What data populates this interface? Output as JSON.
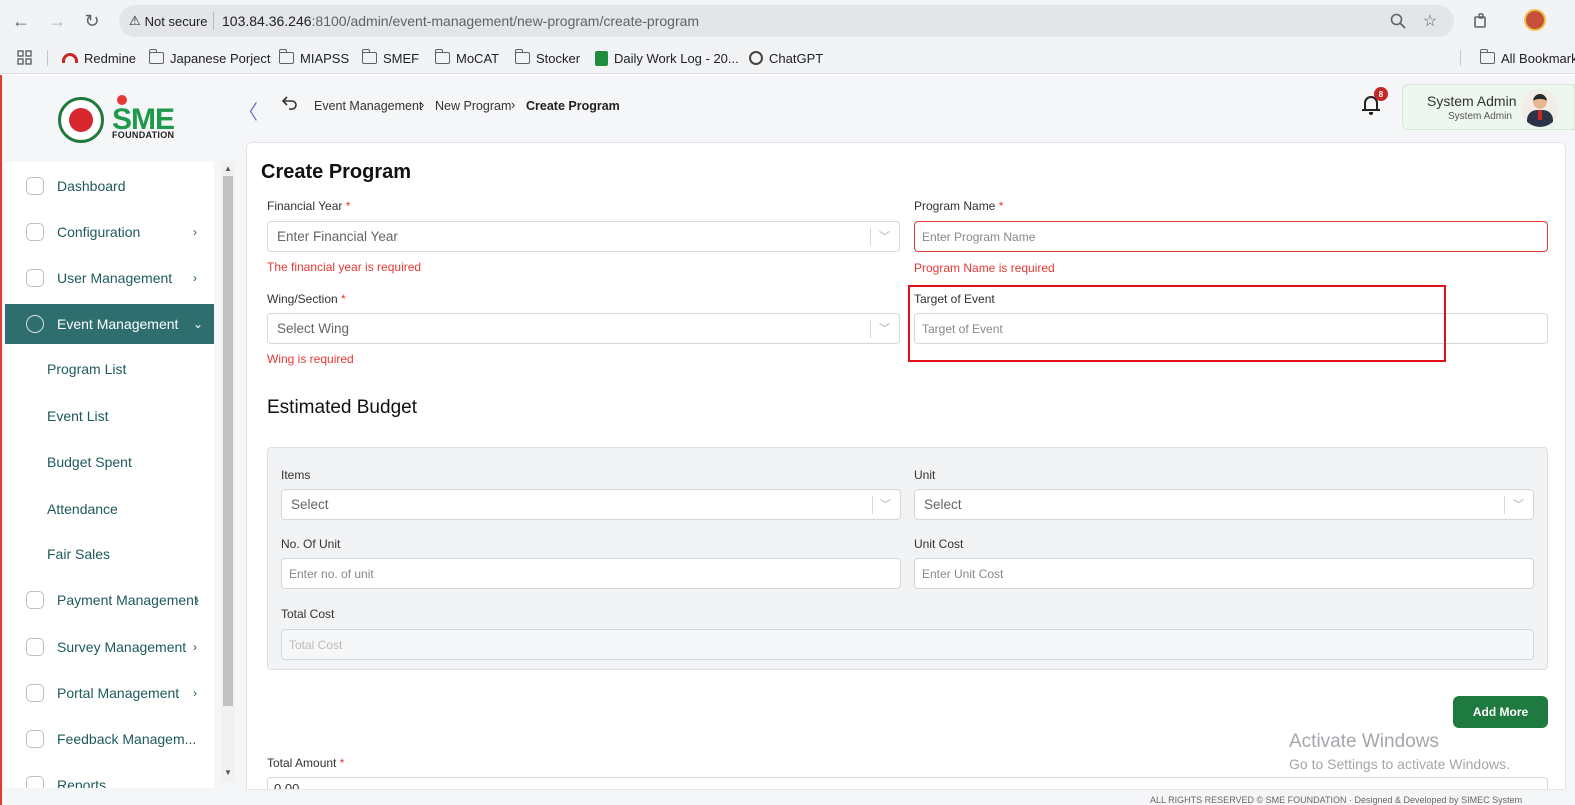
{
  "browser": {
    "security_label": "Not secure",
    "url_host": "103.84.36.246",
    "url_path": ":8100/admin/event-management/new-program/create-program",
    "bookmarks": [
      "Redmine",
      "Japanese Porject",
      "MIAPSS",
      "SMEF",
      "MoCAT",
      "Stocker",
      "Daily Work Log - 20...",
      "ChatGPT"
    ],
    "all_bookmarks": "All Bookmarks"
  },
  "logo": {
    "text": "SME",
    "subtitle": "FOUNDATION"
  },
  "sidebar": {
    "items": [
      {
        "label": "Dashboard",
        "icon": "dashboard-icon"
      },
      {
        "label": "Configuration",
        "icon": "configuration-icon",
        "chevron": "›"
      },
      {
        "label": "User Management",
        "icon": "user-management-icon",
        "chevron": "›"
      },
      {
        "label": "Event Management",
        "icon": "event-management-icon",
        "chevron": "⌄",
        "active": true
      },
      {
        "label": "Payment Management",
        "icon": "payment-icon",
        "chevron": "›"
      },
      {
        "label": "Survey Management",
        "icon": "survey-icon",
        "chevron": "›"
      },
      {
        "label": "Portal Management",
        "icon": "portal-icon",
        "chevron": "›"
      },
      {
        "label": "Feedback Managem...",
        "icon": "feedback-icon"
      },
      {
        "label": "Reports",
        "icon": "reports-icon"
      }
    ],
    "sub_items": [
      "Program List",
      "Event List",
      "Budget Spent",
      "Attendance",
      "Fair Sales"
    ]
  },
  "header": {
    "breadcrumb": [
      "Event Management",
      "New Program",
      "Create Program"
    ],
    "notification_count": "8",
    "user_name": "System Admin",
    "user_role": "System Admin"
  },
  "form": {
    "title": "Create Program",
    "financial_year": {
      "label": "Financial Year",
      "placeholder": "Enter Financial Year",
      "error": "The financial year is required"
    },
    "program_name": {
      "label": "Program Name",
      "placeholder": "Enter Program Name",
      "error": "Program Name is required"
    },
    "wing": {
      "label": "Wing/Section",
      "placeholder": "Select Wing",
      "error": "Wing is required"
    },
    "target_of_event": {
      "label": "Target of Event",
      "placeholder": "Target of Event"
    },
    "required_mark": "*"
  },
  "budget": {
    "title": "Estimated Budget",
    "items": {
      "label": "Items",
      "placeholder": "Select"
    },
    "unit": {
      "label": "Unit",
      "placeholder": "Select"
    },
    "no_of_unit": {
      "label": "No. Of Unit",
      "placeholder": "Enter no. of unit"
    },
    "unit_cost": {
      "label": "Unit Cost",
      "placeholder": "Enter Unit Cost"
    },
    "total_cost": {
      "label": "Total Cost",
      "placeholder": "Total Cost"
    },
    "add_more": "Add More"
  },
  "total_amount": {
    "label": "Total Amount",
    "value": "0.00"
  },
  "watermark": {
    "title": "Activate Windows",
    "subtitle": "Go to Settings to activate Windows."
  },
  "footer": {
    "text": "ALL RIGHTS RESERVED © SME FOUNDATION · Designed & Developed by SIMEC System"
  }
}
